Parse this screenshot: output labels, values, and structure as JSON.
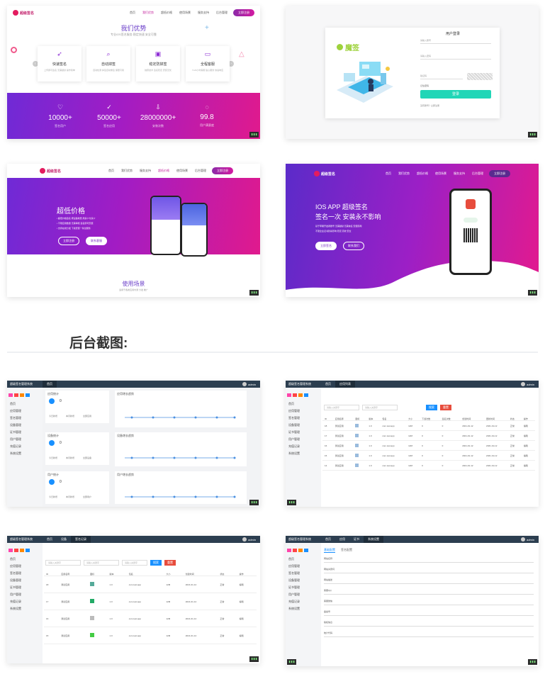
{
  "shot1": {
    "brand": "超级签名",
    "menu": [
      "首页",
      "我们优势",
      "超低价格",
      "使用场景",
      "服务支持",
      "后台管理"
    ],
    "nav_button": "立即注册",
    "title": "我们优势",
    "subtitle": "专业iOS签名服务 稳定快速 安全可靠",
    "features": [
      {
        "title": "快速签名",
        "desc": "上传即可签名 无需越狱 操作简单"
      },
      {
        "title": "自动掉签",
        "desc": "自动检测 掉签自动重签 保障可用"
      },
      {
        "title": "稳定防掉签",
        "desc": "独家技术 签名稳定 安装无忧"
      },
      {
        "title": "全程客服",
        "desc": "7x24小时客服 贴心服务 快速响应"
      }
    ],
    "stats": [
      {
        "num": "10000+",
        "label": "签名用户"
      },
      {
        "num": "50000+",
        "label": "签名应用"
      },
      {
        "num": "28000000+",
        "label": "安装次数"
      },
      {
        "num": "99.8",
        "label": "用户满意度"
      }
    ]
  },
  "shot2": {
    "brand": "魔签",
    "form_title": "用户登录",
    "fields": [
      "请输入账号",
      "请输入密码",
      "验证码"
    ],
    "remember": "记住密码",
    "submit": "登录",
    "register": "没有账号？立即注册"
  },
  "shot3": {
    "brand": "超级签名",
    "menu": [
      "首页",
      "我们优势",
      "服务支持",
      "超低价格",
      "使用场景",
      "后台管理"
    ],
    "nav_button": "立即注册",
    "hero_title": "超低价格",
    "bullets": [
      "• 超低价格签名 按设备收费 用多少付多少",
      "• 不限应用数量 无需审核 签名即可安装",
      "• 支持在线分发 下载安装一条龙服务"
    ],
    "btn_primary": "立即注册",
    "btn_secondary": "联系客服",
    "section_title": "使用场景",
    "section_sub": "适用于各类应用内测 分发 推广"
  },
  "shot4": {
    "brand": "超级签名",
    "menu": [
      "首页",
      "我们优势",
      "超低价格",
      "使用场景",
      "服务支持",
      "后台管理"
    ],
    "nav_button": "立即注册",
    "title_line1": "IOS APP 超级签名",
    "title_line2": "签名一次 安装永不影响",
    "desc1": "基于苹果开发者账号 无需越狱 无需信任 安装即用",
    "desc2": "不受企业证书封杀影响 稳定 高效 安全",
    "btn_primary": "立即签名",
    "btn_secondary": "联系我们"
  },
  "section_heading": "后台截图:",
  "admin": {
    "brand": "超级签名管理系统",
    "user": "admin",
    "side_items": [
      "首页",
      "应用管理",
      "签名管理",
      "设备管理",
      "证书管理",
      "用户管理",
      "充值记录",
      "系统设置"
    ],
    "tabs1": [
      "首页"
    ],
    "tabs2": [
      "首页",
      "应用列表"
    ],
    "tabs3": [
      "首页",
      "设备",
      "签名记录"
    ],
    "tabs4": [
      "首页",
      "应用",
      "证书",
      "系统设置"
    ],
    "panels": [
      {
        "title": "应用统计",
        "num": "0",
        "labels": [
          "今日新增",
          "本月新增",
          "全部应用"
        ]
      },
      {
        "title": "设备统计",
        "num": "0",
        "labels": [
          "今日新增",
          "本月新增",
          "全部设备"
        ]
      },
      {
        "title": "用户统计",
        "num": "0",
        "labels": [
          "今日新增",
          "本月新增",
          "全部用户"
        ]
      }
    ],
    "chart_titles": [
      "应用增长趋势",
      "设备增长趋势",
      "用户增长趋势"
    ],
    "search_placeholder": "请输入关键字",
    "search_btn": "搜索",
    "reset_btn": "重置",
    "list_headers": [
      "ID",
      "应用名称",
      "图标",
      "版本",
      "包名",
      "大小",
      "下载次数",
      "签名次数",
      "创建时间",
      "更新时间",
      "状态",
      "操作"
    ],
    "list_rows": [
      [
        "18",
        "测试应用",
        "",
        "1.0",
        "com.test.app",
        "12M",
        "0",
        "0",
        "2021-01-12",
        "2021-01-12",
        "正常",
        "编辑"
      ],
      [
        "17",
        "测试应用",
        "",
        "1.0",
        "com.test.app",
        "12M",
        "0",
        "0",
        "2021-01-12",
        "2021-01-12",
        "正常",
        "编辑"
      ],
      [
        "16",
        "测试应用",
        "",
        "1.0",
        "com.test.app",
        "12M",
        "0",
        "0",
        "2021-01-12",
        "2021-01-12",
        "正常",
        "编辑"
      ],
      [
        "15",
        "测试应用",
        "",
        "1.0",
        "com.test.app",
        "12M",
        "0",
        "0",
        "2021-01-12",
        "2021-01-12",
        "正常",
        "编辑"
      ],
      [
        "14",
        "测试应用",
        "",
        "1.0",
        "com.test.app",
        "12M",
        "0",
        "0",
        "2021-01-12",
        "2021-01-12",
        "正常",
        "编辑"
      ]
    ],
    "form_tabs": [
      "基础配置",
      "签名配置"
    ],
    "form_labels": [
      "网站名称",
      "网站关键词",
      "网站描述",
      "客服QQ",
      "客服微信",
      "备案号",
      "版权信息",
      "统计代码",
      "上传目录"
    ],
    "status_colors": {
      "blue": "#1890ff",
      "red": "#e74c3c",
      "green": "#3a9f63",
      "navy": "#2c3e50"
    }
  }
}
